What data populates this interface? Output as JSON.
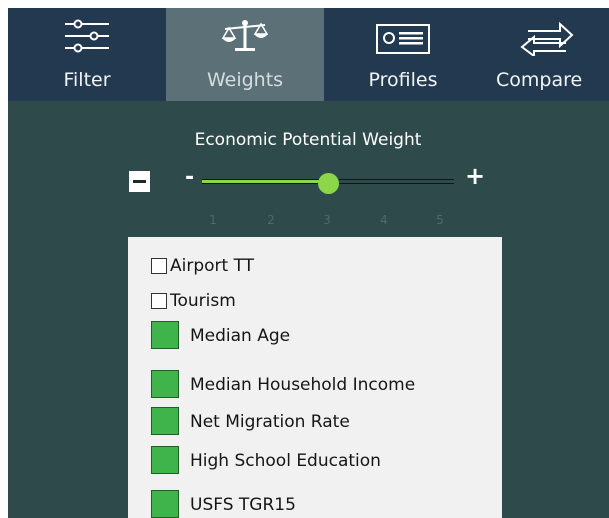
{
  "nav": {
    "tabs": [
      {
        "label": "Filter",
        "icon": "sliders-icon",
        "active": false
      },
      {
        "label": "Weights",
        "icon": "scale-icon",
        "active": true
      },
      {
        "label": "Profiles",
        "icon": "id-card-icon",
        "active": false
      },
      {
        "label": "Compare",
        "icon": "compare-arrows-icon",
        "active": false
      }
    ]
  },
  "weight": {
    "title": "Economic Potential Weight",
    "minus_symbol": "-",
    "plus_symbol": "+",
    "ticks": [
      "1",
      "2",
      "3",
      "4",
      "5"
    ],
    "value": 3,
    "min": 1,
    "max": 5
  },
  "items": [
    {
      "label": "Airport TT",
      "type": "checkbox",
      "checked": false
    },
    {
      "label": "Tourism",
      "type": "checkbox",
      "checked": false
    },
    {
      "label": "Median Age",
      "type": "swatch",
      "color": "#3fb44a"
    },
    {
      "label": "Median Household Income",
      "type": "swatch",
      "color": "#3fb44a"
    },
    {
      "label": "Net Migration Rate",
      "type": "swatch",
      "color": "#3fb44a"
    },
    {
      "label": "High School Education",
      "type": "swatch",
      "color": "#3fb44a"
    },
    {
      "label": "USFS TGR15",
      "type": "swatch",
      "color": "#3fb44a"
    }
  ],
  "colors": {
    "background": "#2e4a4b",
    "nav": "#22394f",
    "active_tab": "#5b7177",
    "accent": "#8cd64a"
  }
}
